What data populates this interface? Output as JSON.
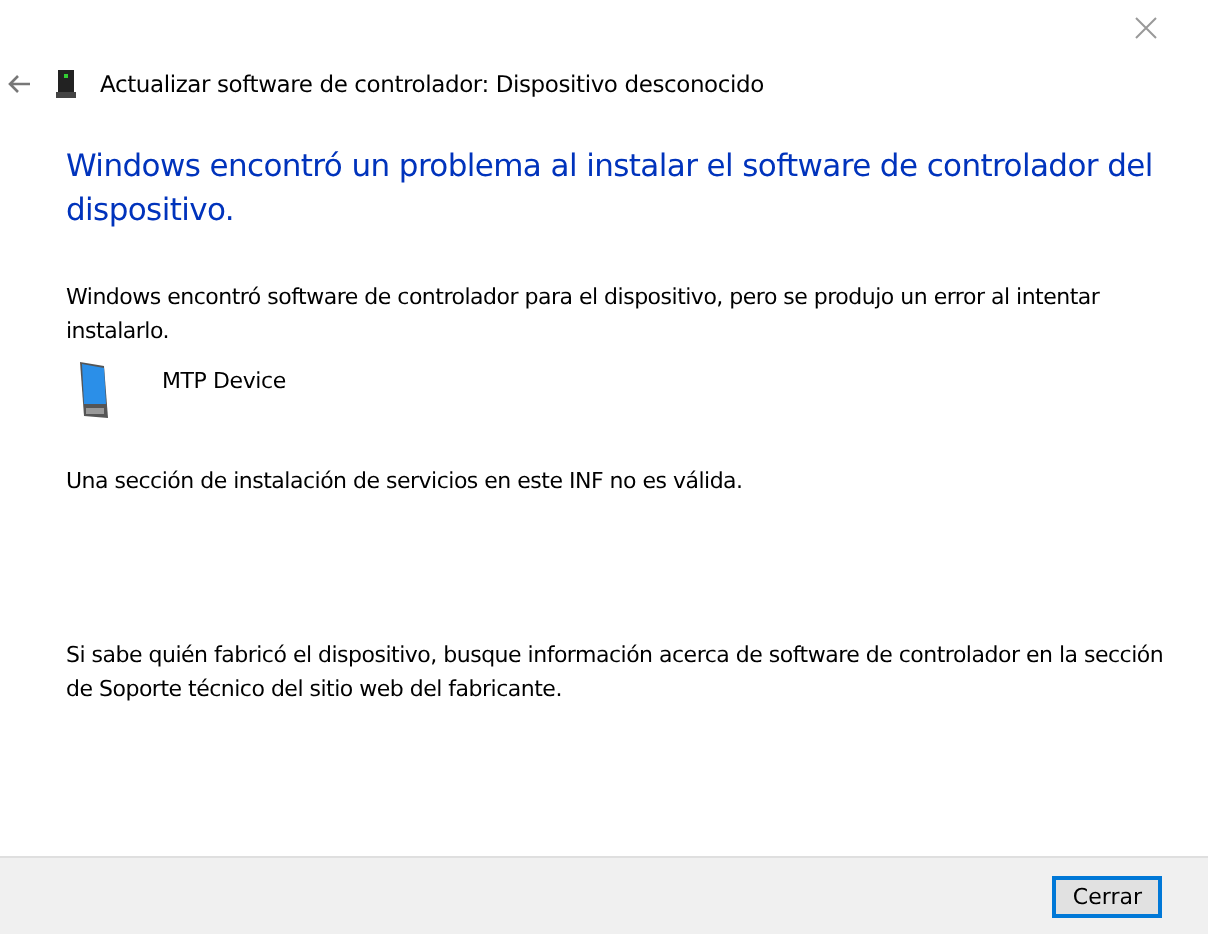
{
  "window": {
    "title": "Actualizar software de controlador: Dispositivo desconocido"
  },
  "heading": "Windows encontró un problema al instalar el software de controlador del dispositivo.",
  "description": "Windows encontró software de controlador para el dispositivo, pero se produjo un error al intentar instalarlo.",
  "device": {
    "name": "MTP Device"
  },
  "error_message": "Una sección de instalación de servicios en este INF no es válida.",
  "help_text": "Si sabe quién fabricó el dispositivo, busque información acerca de software de controlador en la sección de Soporte técnico del sitio web del fabricante.",
  "buttons": [
    {
      "label": "Cerrar",
      "default": true
    }
  ]
}
